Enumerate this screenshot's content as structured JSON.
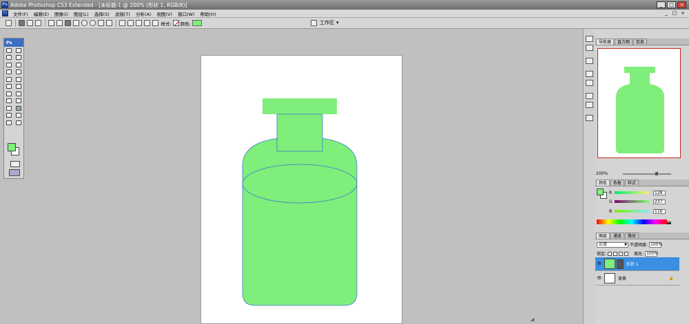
{
  "titlebar": {
    "title": "Adobe Photoshop CS3 Extended - [未标题-1 @ 200% (形状 1, RGB/8)]",
    "minimize": "_",
    "maximize": "□",
    "close": "×"
  },
  "menubar": {
    "items": [
      "文件(F)",
      "编辑(E)",
      "图像(I)",
      "图层(L)",
      "选择(S)",
      "滤镜(T)",
      "分析(A)",
      "视图(V)",
      "窗口(W)",
      "帮助(H)"
    ],
    "doc_minimize": "_",
    "doc_restore": "□",
    "doc_close": "×"
  },
  "options": {
    "style_label": "样式:",
    "color_label": "颜色:",
    "workspace_label": "工作区",
    "color_value": "#7fee7a"
  },
  "toolbox": {
    "header": "Ps",
    "foreground": "#7fee7a",
    "background": "#ffffff"
  },
  "document": {
    "shape_fill": "#7fee7a",
    "path_stroke": "#3a7ad8"
  },
  "panels": {
    "navigator": {
      "tabs": [
        "导航器",
        "直方图",
        "信息"
      ],
      "zoom": "200%"
    },
    "color": {
      "tabs": [
        "颜色",
        "色板",
        "样式"
      ],
      "r_label": "R",
      "g_label": "G",
      "b_label": "B",
      "r": "128",
      "g": "237",
      "b": "116"
    },
    "layers": {
      "tabs": [
        "图层",
        "通道",
        "路径"
      ],
      "blend_mode": "正常",
      "opacity_label": "不透明度:",
      "opacity": "100%",
      "lock_label": "锁定:",
      "fill_label": "填充:",
      "fill": "100%",
      "items": [
        {
          "name": "形状 1",
          "selected": true
        },
        {
          "name": "背景",
          "selected": false
        }
      ]
    }
  }
}
